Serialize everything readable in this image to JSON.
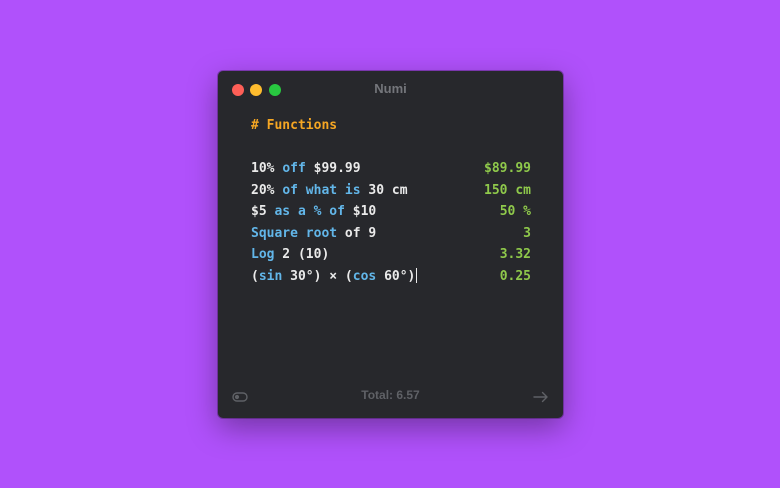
{
  "window": {
    "title": "Numi"
  },
  "editor": {
    "heading": "# Functions",
    "lines": [
      {
        "segments": [
          {
            "text": "10%",
            "kind": "expr"
          },
          {
            "text": " ",
            "kind": "expr"
          },
          {
            "text": "off",
            "kind": "kw"
          },
          {
            "text": " $99.99",
            "kind": "expr"
          }
        ],
        "result": "$89.99"
      },
      {
        "segments": [
          {
            "text": "20%",
            "kind": "expr"
          },
          {
            "text": " ",
            "kind": "expr"
          },
          {
            "text": "of what is",
            "kind": "kw"
          },
          {
            "text": " 30 cm",
            "kind": "expr"
          }
        ],
        "result": "150 cm"
      },
      {
        "segments": [
          {
            "text": "$5",
            "kind": "expr"
          },
          {
            "text": " ",
            "kind": "expr"
          },
          {
            "text": "as a % of",
            "kind": "kw"
          },
          {
            "text": " $10",
            "kind": "expr"
          }
        ],
        "result": "50 %"
      },
      {
        "segments": [
          {
            "text": "Square root",
            "kind": "kw"
          },
          {
            "text": " of 9",
            "kind": "expr"
          }
        ],
        "result": "3"
      },
      {
        "segments": [
          {
            "text": "Log",
            "kind": "kw"
          },
          {
            "text": " 2 (10)",
            "kind": "expr"
          }
        ],
        "result": "3.32"
      },
      {
        "segments": [
          {
            "text": "(",
            "kind": "expr"
          },
          {
            "text": "sin",
            "kind": "kw"
          },
          {
            "text": " 30°) × (",
            "kind": "expr"
          },
          {
            "text": "cos",
            "kind": "kw"
          },
          {
            "text": " 60°)",
            "kind": "expr"
          }
        ],
        "result": "0.25",
        "cursor": true
      }
    ]
  },
  "footer": {
    "total": "Total: 6.57",
    "left_icon": "toggle-icon",
    "right_icon": "arrow-right-icon"
  },
  "colors": {
    "background": "#b051fb",
    "window": "#27282c",
    "heading": "#f5a623",
    "keyword": "#62b6e9",
    "result": "#8fc94b",
    "text": "#eaeaea"
  }
}
